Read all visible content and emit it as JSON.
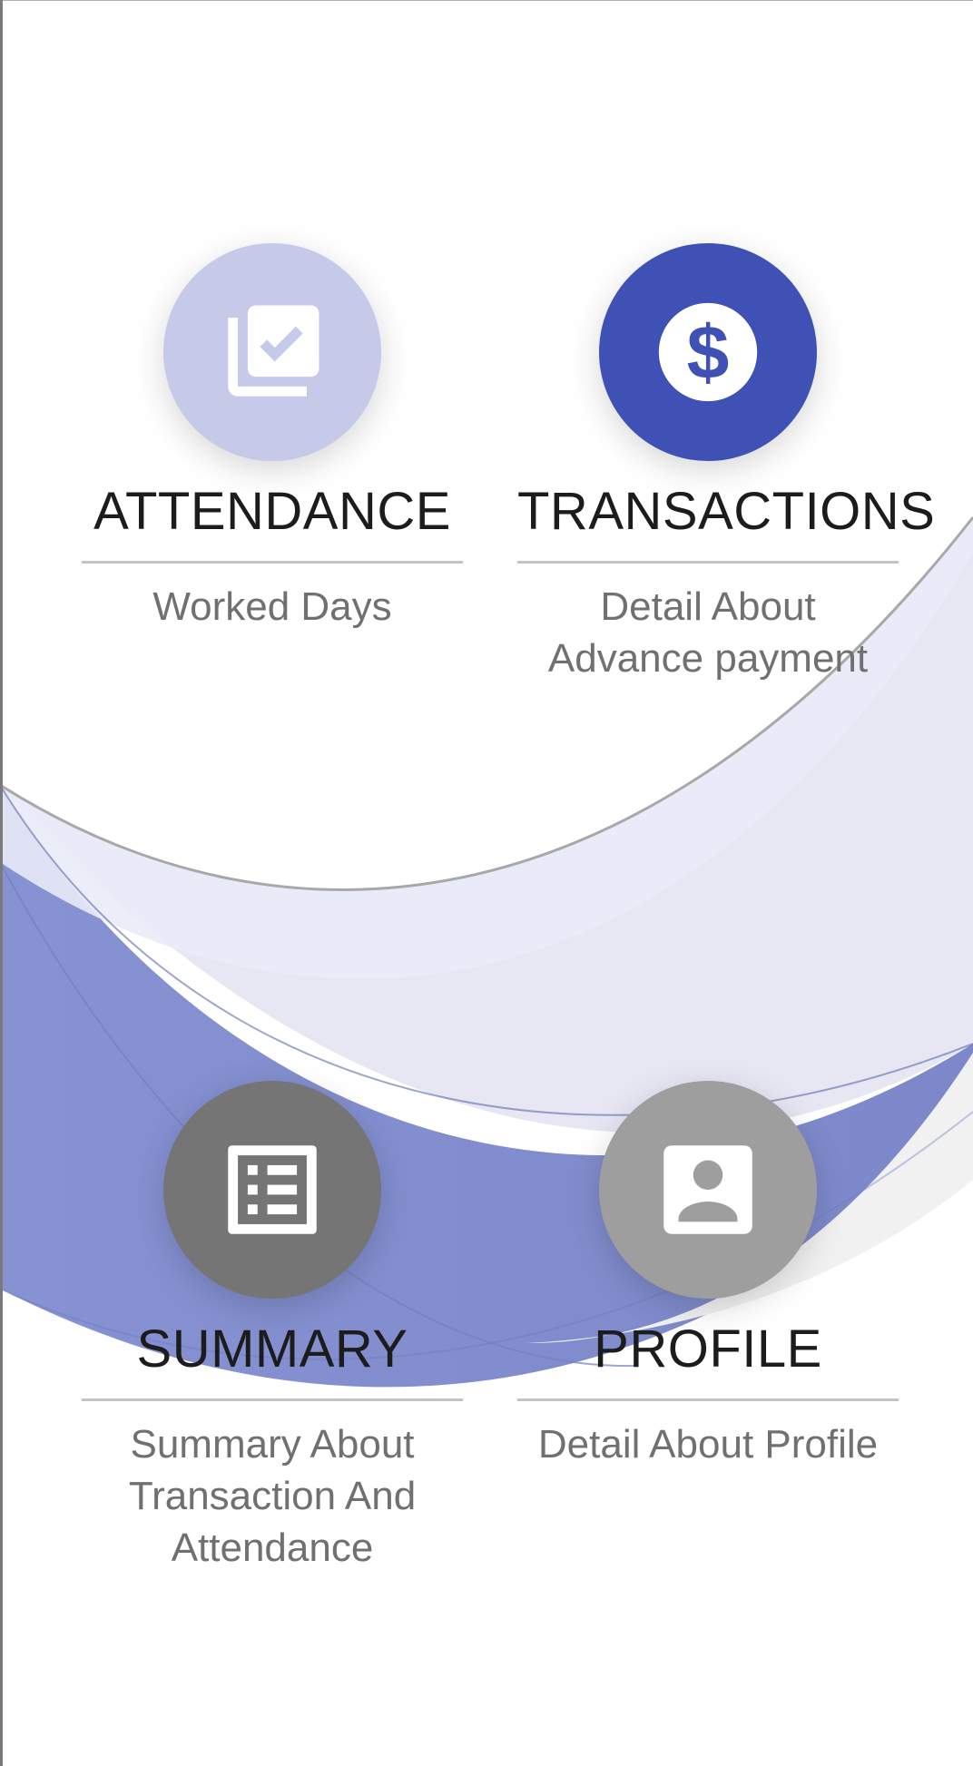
{
  "tiles": {
    "attendance": {
      "title": "ATTENDANCE",
      "subtitle": "Worked Days",
      "icon": "library-add-check-icon",
      "color": "#c5cae9"
    },
    "transactions": {
      "title": "TRANSACTIONS",
      "subtitle_line1": "Detail About",
      "subtitle_line2": "Advance payment",
      "icon": "dollar-circle-icon",
      "color": "#3f51b5"
    },
    "summary": {
      "title": "SUMMARY",
      "subtitle_line1": "Summary About",
      "subtitle_line2": "Transaction And",
      "subtitle_line3": "Attendance",
      "icon": "list-alt-icon",
      "color": "#757575"
    },
    "profile": {
      "title": "PROFILE",
      "subtitle": "Detail About Profile",
      "icon": "account-box-icon",
      "color": "#9e9e9e"
    }
  },
  "theme": {
    "primary": "#3f51b5",
    "wave_light": "#e8eaf6",
    "wave_mid": "#7986cb"
  }
}
